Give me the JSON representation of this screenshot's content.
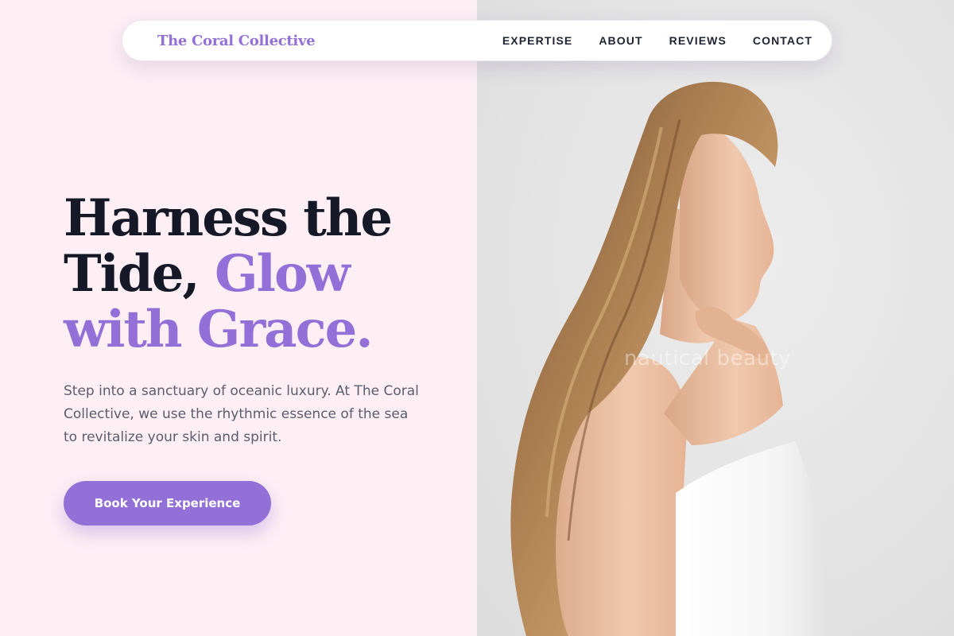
{
  "brand": {
    "name": "The Coral Collective"
  },
  "nav": {
    "items": [
      "EXPERTISE",
      "ABOUT",
      "REVIEWS",
      "CONTACT"
    ]
  },
  "hero": {
    "title_line1": "Harness the",
    "title_line2_dark": "Tide, ",
    "title_line2_accent": "Glow",
    "title_line3_accent": "with Grace.",
    "description": "Step into a sanctuary of oceanic luxury. At The Coral Collective, we use the rhythmic essence of the sea to revitalize your skin and spirit.",
    "cta_label": "Book Your Experience",
    "image_watermark": "nautical beauty"
  },
  "colors": {
    "accent": "#9370d8",
    "heading": "#151827",
    "body_text": "#5a5d6e",
    "left_background": "#fdeff4",
    "right_background": "#e4e4e4"
  }
}
